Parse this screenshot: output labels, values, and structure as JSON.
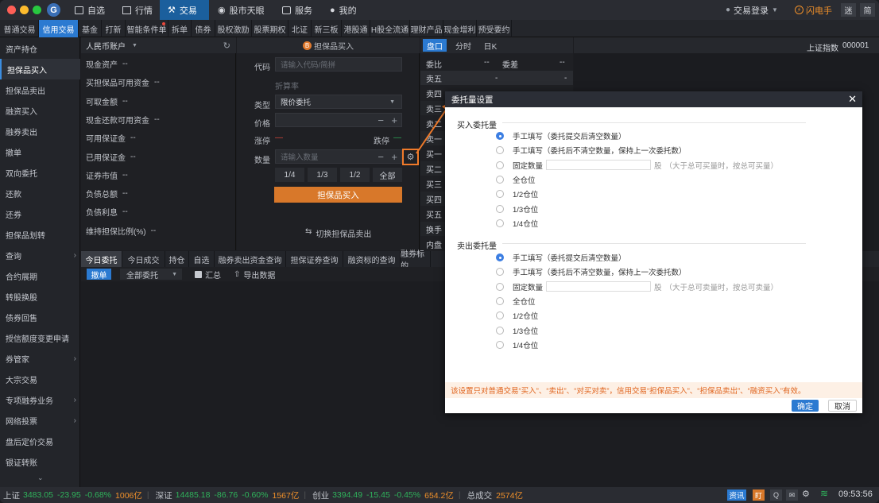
{
  "window": {
    "traffic_colors": [
      "#ff5f57",
      "#febc2e",
      "#28c840"
    ],
    "top_nav": [
      "自选",
      "行情",
      "交易",
      "股市天眼",
      "服务",
      "我的"
    ],
    "login_label": "交易登录",
    "flash_label": "闪电手",
    "btn_fan": "迷",
    "btn_jian": "简"
  },
  "tabs": [
    "普通交易",
    "信用交易",
    "基金",
    "打新",
    "智能条件单",
    "拆单",
    "债券",
    "股权激励",
    "股票期权",
    "北证",
    "新三板",
    "港股通",
    "H股全流通",
    "理财产品",
    "现金增利",
    "预受要约"
  ],
  "sidebar": [
    "资产持仓",
    "担保品买入",
    "担保品卖出",
    "融资买入",
    "融券卖出",
    "撤单",
    "双向委托",
    "还款",
    "还券",
    "担保品划转",
    "查询",
    "合约展期",
    "转股换股",
    "债券回售",
    "授信额度变更申请",
    "券管家",
    "大宗交易",
    "专项融券业务",
    "网络投票",
    "盘后定价交易",
    "银证转账"
  ],
  "assets": {
    "account": "人民币账户",
    "rows": [
      {
        "label": "现金资产",
        "value": "--"
      },
      {
        "label": "买担保品可用资金",
        "value": "--"
      },
      {
        "label": "可取金额",
        "value": "--"
      },
      {
        "label": "现金还款可用资金",
        "value": "--"
      },
      {
        "label": "可用保证金",
        "value": "--"
      },
      {
        "label": "已用保证金",
        "value": "--"
      },
      {
        "label": "证券市值",
        "value": "--"
      },
      {
        "label": "负债总额",
        "value": "--"
      },
      {
        "label": "负债利息",
        "value": "--"
      },
      {
        "label": "维持担保比例(%)",
        "value": "--"
      }
    ]
  },
  "order": {
    "title": "担保品买入",
    "badge": "B",
    "code_label": "代码",
    "code_placeholder": "请输入代码/简拼",
    "calc": "折算率",
    "type_label": "类型",
    "type_value": "限价委托",
    "price_label": "价格",
    "up_label": "涨停",
    "up_value": "—",
    "down_label": "跌停",
    "down_value": "—",
    "qty_label": "数量",
    "qty_placeholder": "请输入数量",
    "fractions": [
      "1/4",
      "1/3",
      "1/2",
      "全部"
    ],
    "submit": "担保品买入",
    "switch": "切换担保品卖出"
  },
  "quotes": {
    "tabs": [
      "盘口",
      "分时",
      "日K"
    ],
    "ratio": "委比",
    "ratio_val": "--",
    "diff": "委差",
    "diff_val": "--",
    "sell5": "卖五",
    "rows": [
      "卖四",
      "卖三",
      "卖二",
      "卖一",
      "买一",
      "买二",
      "买三",
      "买四",
      "买五",
      "换手",
      "内盘"
    ]
  },
  "index": {
    "label": "上证指数",
    "code": "000001"
  },
  "bottom_tabs": [
    "今日委托",
    "今日成交",
    "持仓",
    "自选",
    "融券卖出资金查询",
    "担保证券查询",
    "融资标的查询",
    "融券标的"
  ],
  "toolbar": {
    "cancel": "撤单",
    "filter": "全部委托",
    "summary": "汇总",
    "export": "导出数据"
  },
  "modal": {
    "title": "委托量设置",
    "buy_title": "买入委托量",
    "sell_title": "卖出委托量",
    "options": [
      "手工填写（委托提交后清空数量）",
      "手工填写（委托后不清空数量，保持上一次委托数）",
      "固定数量",
      "全仓位",
      "1/2仓位",
      "1/3仓位",
      "1/4仓位"
    ],
    "share_unit": "股",
    "share_hint": "（大于总可买量时，按总可买量）",
    "share_hint_sell": "（大于总可卖量时，按总可卖量）",
    "notice": "该设置只对普通交易“买入”、“卖出”、“对买对卖”，信用交易“担保品买入”、“担保品卖出”、“融资买入”有效。",
    "ok": "确定",
    "cancel": "取消"
  },
  "status": {
    "sh_label": "上证",
    "sh_val": "3483.05",
    "sh_chg": "-23.95",
    "sh_pct": "-0.68%",
    "sh_amt": "1006亿",
    "sz_label": "深证",
    "sz_val": "14485.18",
    "sz_chg": "-86.76",
    "sz_pct": "-0.60%",
    "sz_amt": "1567亿",
    "cy_label": "创业",
    "cy_val": "3394.49",
    "cy_chg": "-15.45",
    "cy_pct": "-0.45%",
    "cy_amt": "654.2亿",
    "total_label": "总成交",
    "total_amt": "2574亿",
    "news": "资讯",
    "time": "09:53:56"
  }
}
